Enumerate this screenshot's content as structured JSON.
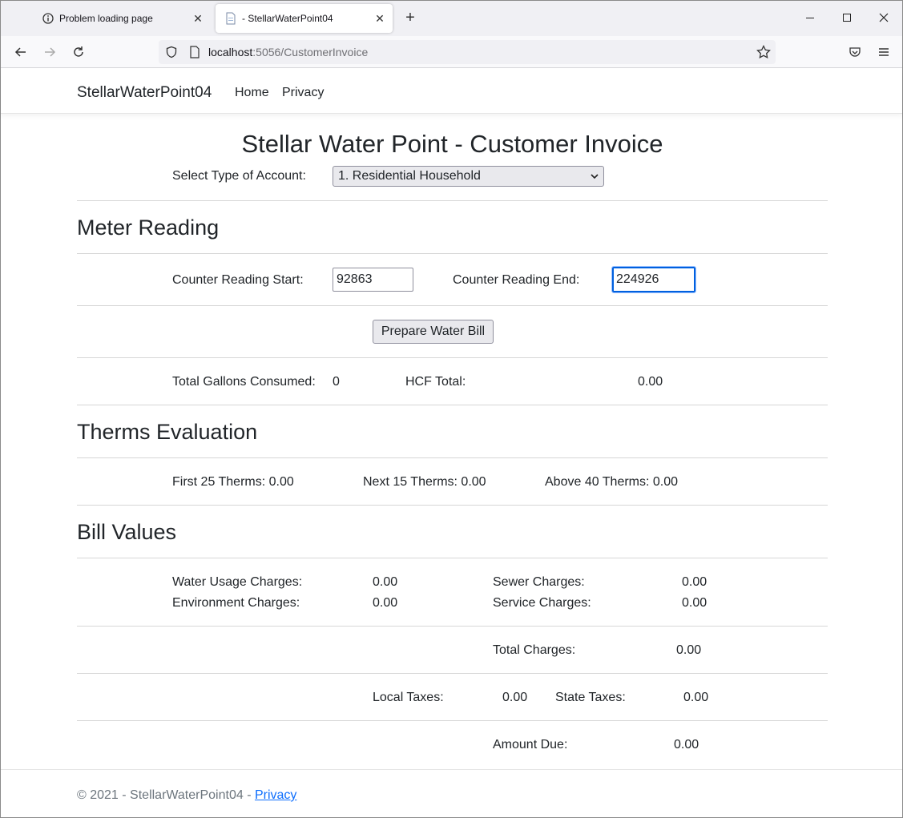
{
  "browser": {
    "tabs": [
      {
        "label": "Problem loading page",
        "icon": "info-icon"
      },
      {
        "label": "- StellarWaterPoint04",
        "icon": "page-icon"
      }
    ],
    "url_host": "localhost",
    "url_path": ":5056/CustomerInvoice"
  },
  "site": {
    "brand": "StellarWaterPoint04",
    "nav": [
      "Home",
      "Privacy"
    ]
  },
  "page": {
    "title": "Stellar Water Point - Customer Invoice",
    "account_label": "Select Type of Account:",
    "account_selected": "1. Residential Household",
    "meter_section": "Meter Reading",
    "counter_start_label": "Counter Reading Start:",
    "counter_start_value": "92863",
    "counter_end_label": "Counter Reading End:",
    "counter_end_value": "224926",
    "prepare_button": "Prepare Water Bill",
    "gallons_label": "Total Gallons Consumed:",
    "gallons_value": "0",
    "hcf_label": "HCF Total:",
    "hcf_value": "0.00",
    "therms_section": "Therms Evaluation",
    "first25": "First 25 Therms: 0.00",
    "next15": "Next 15 Therms: 0.00",
    "above40": "Above 40 Therms: 0.00",
    "bill_section": "Bill Values",
    "water_usage_label": "Water Usage Charges:",
    "water_usage_value": "0.00",
    "sewer_label": "Sewer Charges:",
    "sewer_value": "0.00",
    "environment_label": "Environment Charges:",
    "environment_value": "0.00",
    "service_label": "Service Charges:",
    "service_value": "0.00",
    "total_charges_label": "Total Charges:",
    "total_charges_value": "0.00",
    "local_taxes_label": "Local Taxes:",
    "local_taxes_value": "0.00",
    "state_taxes_label": "State Taxes:",
    "state_taxes_value": "0.00",
    "amount_due_label": "Amount Due:",
    "amount_due_value": "0.00"
  },
  "footer": {
    "text": "© 2021 - StellarWaterPoint04 - ",
    "link": "Privacy"
  }
}
